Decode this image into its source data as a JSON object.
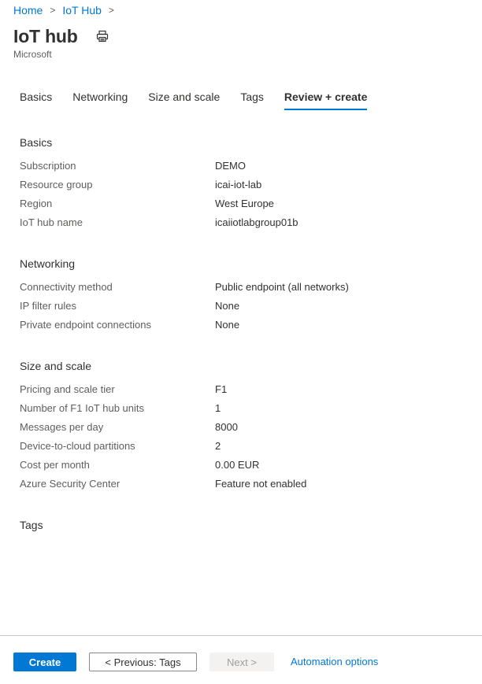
{
  "breadcrumb": {
    "items": [
      "Home",
      "IoT Hub"
    ]
  },
  "header": {
    "title": "IoT hub",
    "subtitle": "Microsoft",
    "print_icon": "print-icon"
  },
  "tabs": [
    {
      "label": "Basics",
      "active": false
    },
    {
      "label": "Networking",
      "active": false
    },
    {
      "label": "Size and scale",
      "active": false
    },
    {
      "label": "Tags",
      "active": false
    },
    {
      "label": "Review + create",
      "active": true
    }
  ],
  "sections": {
    "basics": {
      "title": "Basics",
      "rows": [
        {
          "label": "Subscription",
          "value": "DEMO"
        },
        {
          "label": "Resource group",
          "value": "icai-iot-lab"
        },
        {
          "label": "Region",
          "value": "West Europe"
        },
        {
          "label": "IoT hub name",
          "value": "icaiiotlabgroup01b"
        }
      ]
    },
    "networking": {
      "title": "Networking",
      "rows": [
        {
          "label": "Connectivity method",
          "value": "Public endpoint (all networks)"
        },
        {
          "label": "IP filter rules",
          "value": "None"
        },
        {
          "label": "Private endpoint connections",
          "value": "None"
        }
      ]
    },
    "size_scale": {
      "title": "Size and scale",
      "rows": [
        {
          "label": "Pricing and scale tier",
          "value": "F1"
        },
        {
          "label": "Number of F1 IoT hub units",
          "value": "1"
        },
        {
          "label": "Messages per day",
          "value": "8000"
        },
        {
          "label": "Device-to-cloud partitions",
          "value": "2"
        },
        {
          "label": "Cost per month",
          "value": "0.00 EUR"
        },
        {
          "label": "Azure Security Center",
          "value": "Feature not enabled"
        }
      ]
    },
    "tags": {
      "title": "Tags"
    }
  },
  "footer": {
    "create_label": "Create",
    "previous_label": "< Previous: Tags",
    "next_label": "Next >",
    "automation_label": "Automation options"
  },
  "colors": {
    "accent": "#0078d4",
    "text": "#323130",
    "muted": "#605e5c",
    "disabled_bg": "#f3f2f1",
    "disabled_text": "#a19f9d"
  }
}
